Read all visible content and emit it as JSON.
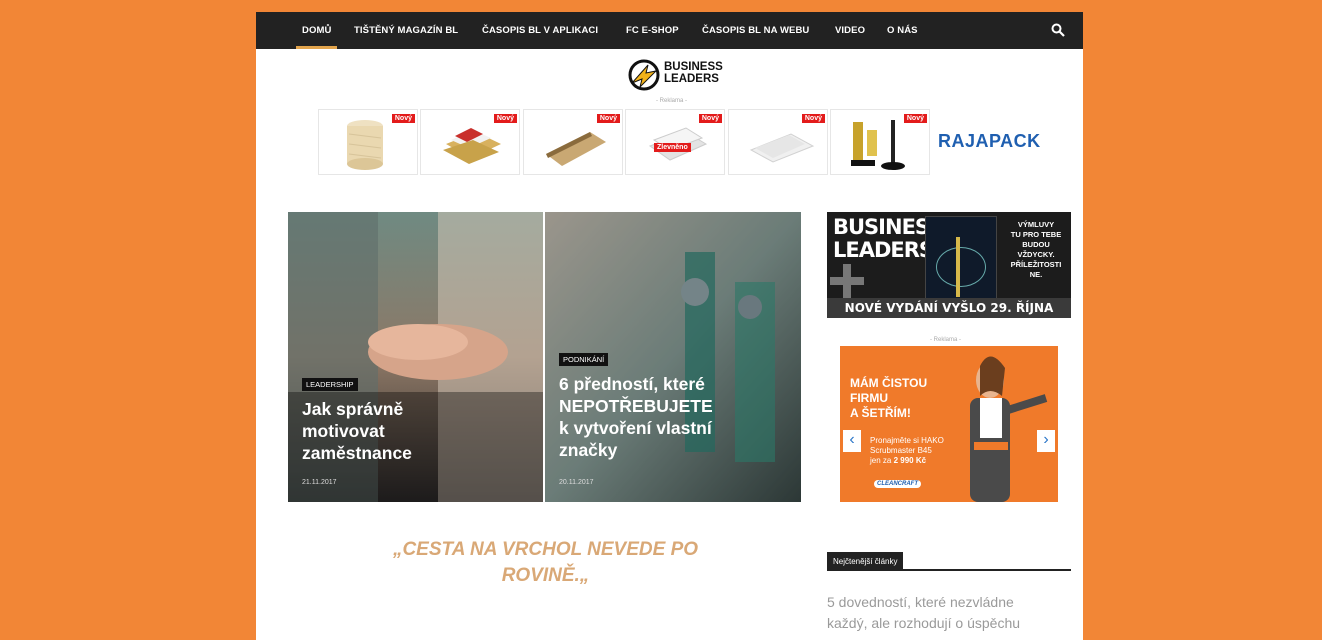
{
  "nav": {
    "items": [
      {
        "label": "DOMŮ"
      },
      {
        "label": "TIŠTĚNÝ MAGAZÍN BL"
      },
      {
        "label": "ČASOPIS BL V APLIKACI"
      },
      {
        "label": "FC E-SHOP"
      },
      {
        "label": "ČASOPIS BL NA WEBU"
      },
      {
        "label": "VIDEO"
      },
      {
        "label": "O NÁS"
      }
    ]
  },
  "logo": {
    "line1": "BUSINESS",
    "line2": "LEADERS"
  },
  "top_ad": {
    "label": "- Reklama -",
    "badge": "Nový",
    "discount": "Zlevněno",
    "brand": "RAJAPACK"
  },
  "featured": [
    {
      "tag": "LEADERSHIP",
      "title_lines": [
        "Jak správně",
        "motivovat",
        "zaměstnance"
      ],
      "date": "21.11.2017"
    },
    {
      "tag": "PODNIKÁNÍ",
      "title_lines": [
        "6 předností, které",
        "NEPOTŘEBUJETE",
        "k vytvoření vlastní",
        "značky"
      ],
      "date": "20.11.2017"
    }
  ],
  "quote": {
    "line1": "„CESTA NA VRCHOL NEVEDE PO",
    "line2": "ROVINĚ.„"
  },
  "promo": {
    "brand1": "BUSINESS",
    "brand2": "LEADERS",
    "side_lines": [
      "VÝMLUVY",
      "TU PRO TEBE",
      "BUDOU",
      "VŽDYCKY.",
      "PŘÍLEŽITOSTI",
      "NE."
    ],
    "footer": "NOVÉ VYDÁNÍ VYŠLO 29. ŘÍJNA"
  },
  "side_ad": {
    "label": "- Reklama -",
    "headline_lines": [
      "MÁM ČISTOU",
      "FIRMU",
      "A ŠETŘÍM!"
    ],
    "text_lines": [
      "Pronajměte si HAKO",
      "Scrubmaster B45",
      "jen za"
    ],
    "price": "2 990 Kč",
    "sponsor": "CLEANCRAFT"
  },
  "most_read": {
    "title": "Nejčtenější články",
    "article_lines": [
      "5 dovedností, které nezvládne",
      "každý, ale rozhodují o úspěchu"
    ]
  },
  "colors": {
    "background": "#f28636",
    "nav": "#222222",
    "accent": "#e2a44c",
    "quote": "#d9a876",
    "badge": "#e31b1b"
  }
}
